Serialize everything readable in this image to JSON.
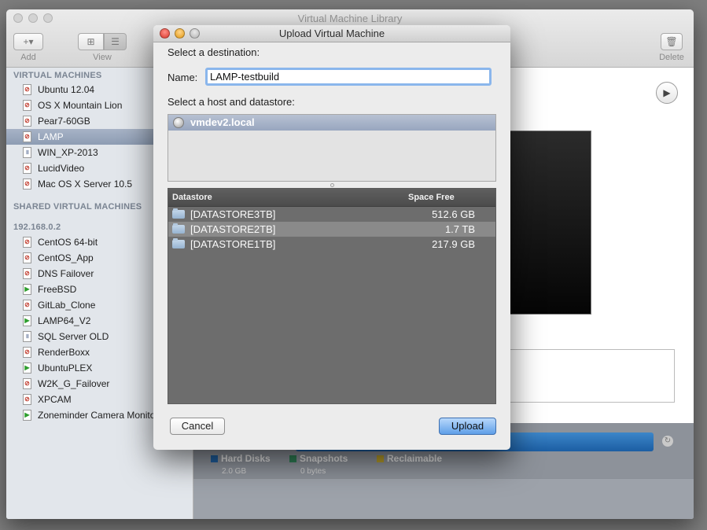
{
  "main_window": {
    "title": "Virtual Machine Library",
    "toolbar": {
      "add_symbol": "+▾",
      "add_label": "Add",
      "view_label": "View",
      "delete_label": "Delete"
    }
  },
  "sidebar": {
    "virtual_machines_header": "VIRTUAL MACHINES",
    "vms": [
      {
        "label": "Ubuntu 12.04"
      },
      {
        "label": "OS X Mountain Lion"
      },
      {
        "label": "Pear7-60GB"
      },
      {
        "label": "LAMP"
      },
      {
        "label": "WIN_XP-2013"
      },
      {
        "label": "LucidVideo"
      },
      {
        "label": "Mac OS X Server 10.5"
      }
    ],
    "shared_header": "SHARED VIRTUAL MACHINES",
    "host_header": "192.168.0.2",
    "shared_vms": [
      {
        "label": "CentOS 64-bit"
      },
      {
        "label": "CentOS_App"
      },
      {
        "label": "DNS Failover"
      },
      {
        "label": "FreeBSD"
      },
      {
        "label": "GitLab_Clone"
      },
      {
        "label": "LAMP64_V2"
      },
      {
        "label": "SQL Server OLD"
      },
      {
        "label": "RenderBoxx"
      },
      {
        "label": "UbuntuPLEX"
      },
      {
        "label": "W2K_G_Failover"
      },
      {
        "label": "XPCAM"
      },
      {
        "label": "Zoneminder Camera Monitor"
      }
    ],
    "selected": "LAMP"
  },
  "storage_legend": {
    "hard_disks_label": "Hard Disks",
    "hard_disks_value": "2.0 GB",
    "snapshots_label": "Snapshots",
    "snapshots_value": "0 bytes",
    "reclaimable_label": "Reclaimable"
  },
  "dialog": {
    "title": "Upload Virtual Machine",
    "select_destination": "Select a destination:",
    "name_label": "Name:",
    "name_value": "LAMP-testbuild",
    "select_host_label": "Select a host and datastore:",
    "host": "vmdev2.local",
    "table_headers": {
      "datastore": "Datastore",
      "space_free": "Space Free"
    },
    "datastores": [
      {
        "name": "[DATASTORE3TB]",
        "free": "512.6 GB"
      },
      {
        "name": "[DATASTORE2TB]",
        "free": "1.7 TB"
      },
      {
        "name": "[DATASTORE1TB]",
        "free": "217.9 GB"
      }
    ],
    "cancel_label": "Cancel",
    "upload_label": "Upload"
  },
  "colors": {
    "accent_blue": "#5f9fe8",
    "selection": "#98a6bf",
    "hard_disks": "#1f5f9e",
    "snapshots": "#2f7f55",
    "reclaimable": "#b59b2a"
  }
}
